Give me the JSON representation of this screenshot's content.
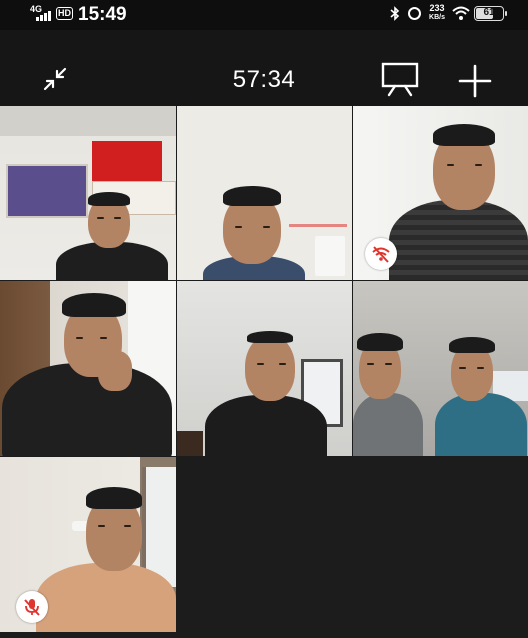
{
  "status_bar": {
    "network": "4G",
    "hd_label": "HD",
    "time": "15:49",
    "speed_value": "233",
    "speed_unit": "KB/s",
    "battery": "61"
  },
  "toolbar": {
    "timer": "57:34",
    "minimize_icon": "minimize-arrows-icon",
    "screen_icon": "screen-share-icon",
    "add_icon": "plus-icon"
  },
  "participants": [
    {
      "muted": false,
      "network_bad": false
    },
    {
      "muted": false,
      "network_bad": false
    },
    {
      "muted": false,
      "network_bad": true
    },
    {
      "muted": false,
      "network_bad": false
    },
    {
      "muted": false,
      "network_bad": false
    },
    {
      "muted": false,
      "network_bad": false
    },
    {
      "muted": true,
      "network_bad": false
    }
  ],
  "colors": {
    "background": "#141414",
    "accent_red": "#e0342e"
  }
}
